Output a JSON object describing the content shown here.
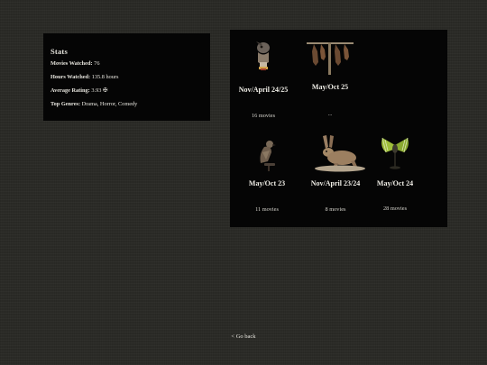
{
  "stats": {
    "title": "Stats",
    "movies_watched_label": "Movies Watched:",
    "movies_watched_value": "76",
    "hours_watched_label": "Hours Watched:",
    "hours_watched_value": "135.8 hours",
    "average_rating_label": "Average Rating:",
    "average_rating_value": "3.93 ✠",
    "top_genres_label": "Top Genres:",
    "top_genres_value": "Drama, Horror, Comedy"
  },
  "collections": [
    {
      "name": "Nov/April 24/25",
      "count": "16 movies",
      "icon": "bird-skull-specimen-icon"
    },
    {
      "name": "May/Oct 25",
      "count": "...",
      "icon": "hanging-bats-icon"
    },
    {
      "name": "May/Oct 23",
      "count": "11 movies",
      "icon": "perched-bird-icon"
    },
    {
      "name": "Nov/April 23/24",
      "count": "8 movies",
      "icon": "hare-specimen-icon"
    },
    {
      "name": "May/Oct 24",
      "count": "28 movies",
      "icon": "green-bat-icon"
    }
  ],
  "footer": {
    "go_back_label": "< Go back"
  },
  "colors": {
    "background": "#2b2b27",
    "panel": "#050505",
    "text": "#e8e6df"
  }
}
